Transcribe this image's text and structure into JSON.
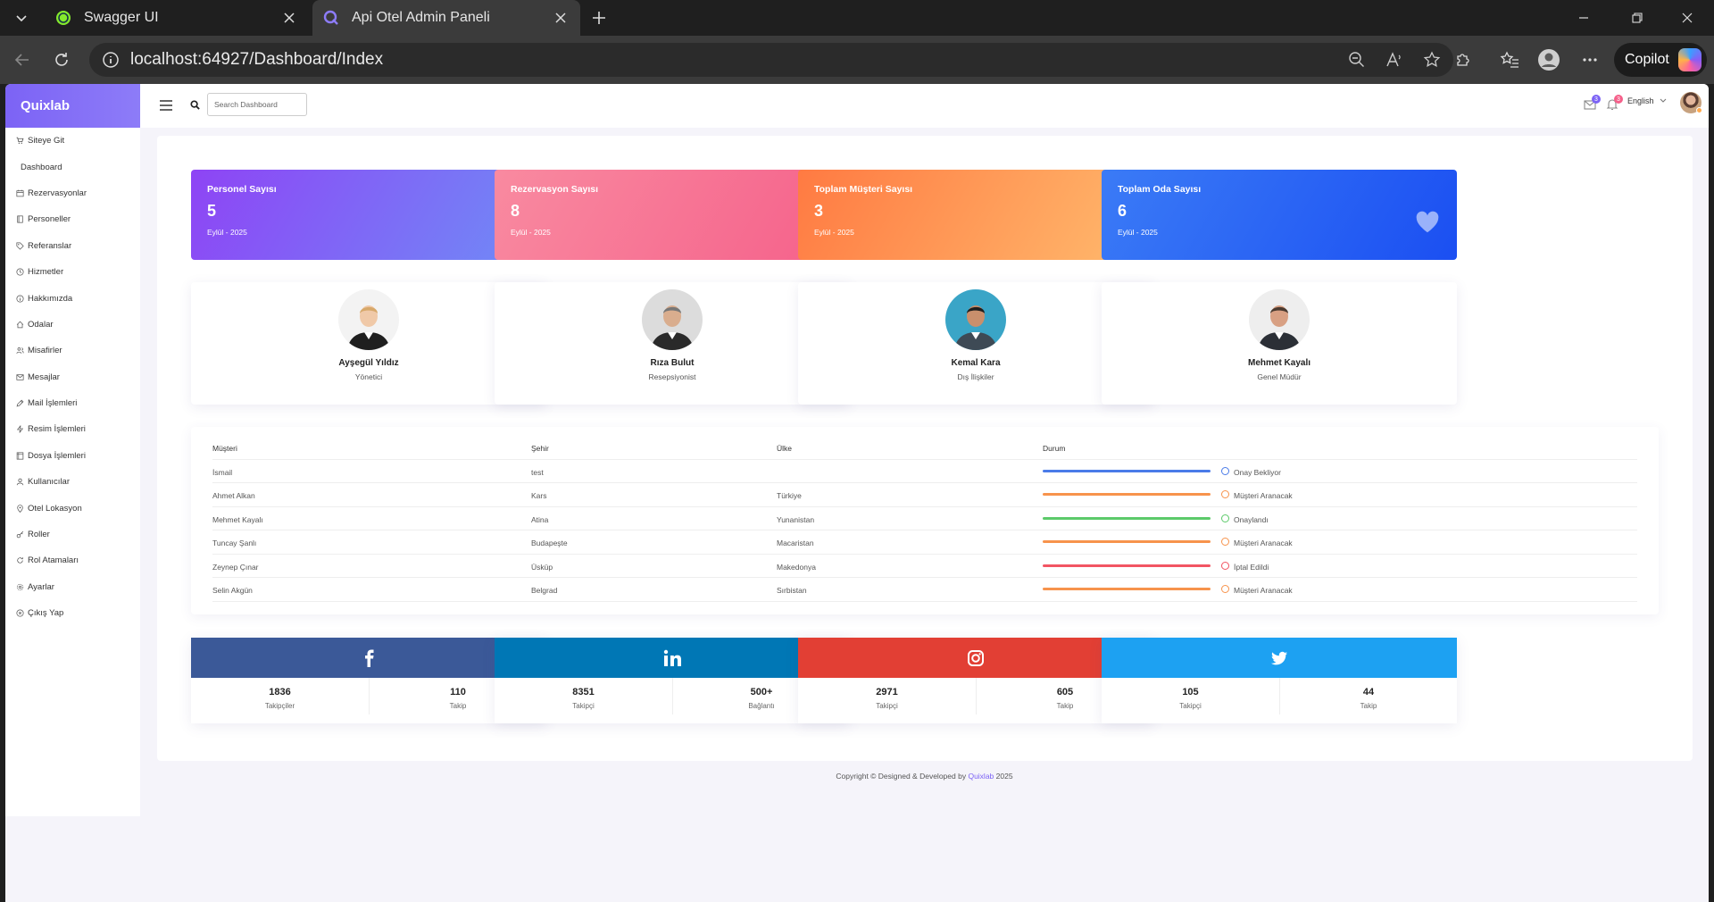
{
  "browser": {
    "tabs": [
      {
        "title": "Swagger UI",
        "icon": "swagger-icon"
      },
      {
        "title": "Api Otel Admin Paneli",
        "icon": "quixlab-icon",
        "active": true
      }
    ],
    "url": "localhost:64927/Dashboard/Index",
    "copilot_label": "Copilot"
  },
  "brand": "Quixlab",
  "sidebar": {
    "items": [
      {
        "label": "Siteye Git",
        "icon": "cart-icon"
      },
      {
        "label": "Dashboard",
        "icon": ""
      },
      {
        "label": "Rezervasyonlar",
        "icon": "calendar-icon"
      },
      {
        "label": "Personeller",
        "icon": "book-icon"
      },
      {
        "label": "Referanslar",
        "icon": "tag-icon"
      },
      {
        "label": "Hizmetler",
        "icon": "clock-icon"
      },
      {
        "label": "Hakkımızda",
        "icon": "info-icon"
      },
      {
        "label": "Odalar",
        "icon": "home-icon"
      },
      {
        "label": "Misafirler",
        "icon": "users-icon"
      },
      {
        "label": "Mesajlar",
        "icon": "mail-icon"
      },
      {
        "label": "Mail İşlemleri",
        "icon": "pencil-icon"
      },
      {
        "label": "Resim İşlemleri",
        "icon": "bolt-icon"
      },
      {
        "label": "Dosya İşlemleri",
        "icon": "file-icon"
      },
      {
        "label": "Kullanıcılar",
        "icon": "user-icon"
      },
      {
        "label": "Otel Lokasyon",
        "icon": "location-icon"
      },
      {
        "label": "Roller",
        "icon": "key-icon"
      },
      {
        "label": "Rol Atamaları",
        "icon": "refresh-icon"
      },
      {
        "label": "Ayarlar",
        "icon": "gear-icon"
      },
      {
        "label": "Çıkış Yap",
        "icon": "logout-icon"
      }
    ]
  },
  "header": {
    "search_placeholder": "Search Dashboard",
    "mail_badge": "3",
    "bell_badge": "3",
    "language": "English"
  },
  "stats": [
    {
      "label": "Personel Sayısı",
      "value": "5",
      "sub": "Eylül - 2025",
      "icon": "cart-icon",
      "gradient": [
        "#8e44f5",
        "#6f8df7"
      ]
    },
    {
      "label": "Rezervasyon Sayısı",
      "value": "8",
      "sub": "Eylül - 2025",
      "icon": "money-icon",
      "gradient": [
        "#f98aa0",
        "#f5608a"
      ]
    },
    {
      "label": "Toplam Müşteri Sayısı",
      "value": "3",
      "sub": "Eylül - 2025",
      "icon": "users-icon",
      "gradient": [
        "#ff7a42",
        "#ffbb6e"
      ]
    },
    {
      "label": "Toplam Oda Sayısı",
      "value": "6",
      "sub": "Eylül - 2025",
      "icon": "heart-icon",
      "gradient": [
        "#3b7bf6",
        "#1b4ff2"
      ]
    }
  ],
  "staff": [
    {
      "name": "Ayşegül Yıldız",
      "role": "Yönetici"
    },
    {
      "name": "Rıza Bulut",
      "role": "Resepsiyonist"
    },
    {
      "name": "Kemal Kara",
      "role": "Dış İlişkiler"
    },
    {
      "name": "Mehmet Kayalı",
      "role": "Genel Müdür"
    }
  ],
  "table": {
    "headers": [
      "Müşteri",
      "Şehir",
      "Ülke",
      "Durum"
    ],
    "rows": [
      {
        "customer": "İsmail",
        "city": "test",
        "country": "",
        "status": "Onay Bekliyor",
        "color": "#4a7be8"
      },
      {
        "customer": "Ahmet Alkan",
        "city": "Kars",
        "country": "Türkiye",
        "status": "Müşteri Aranacak",
        "color": "#f7934c"
      },
      {
        "customer": "Mehmet Kayalı",
        "city": "Atina",
        "country": "Yunanistan",
        "status": "Onaylandı",
        "color": "#5cca6a"
      },
      {
        "customer": "Tuncay Şanlı",
        "city": "Budapeşte",
        "country": "Macaristan",
        "status": "Müşteri Aranacak",
        "color": "#f7934c"
      },
      {
        "customer": "Zeynep Çınar",
        "city": "Üsküp",
        "country": "Makedonya",
        "status": "İptal Edildi",
        "color": "#f25563"
      },
      {
        "customer": "Selin Akgün",
        "city": "Belgrad",
        "country": "Sırbistan",
        "status": "Müşteri Aranacak",
        "color": "#f7934c"
      }
    ]
  },
  "social": [
    {
      "network": "facebook",
      "icon": "facebook-icon",
      "color": "#3b5998",
      "left_value": "1836",
      "left_label": "Takipçiler",
      "right_value": "110",
      "right_label": "Takip"
    },
    {
      "network": "linkedin",
      "icon": "linkedin-icon",
      "color": "#0077b5",
      "left_value": "8351",
      "left_label": "Takipçi",
      "right_value": "500+",
      "right_label": "Bağlantı"
    },
    {
      "network": "instagram",
      "icon": "instagram-icon",
      "color": "#e23f34",
      "left_value": "2971",
      "left_label": "Takipçi",
      "right_value": "605",
      "right_label": "Takip"
    },
    {
      "network": "twitter",
      "icon": "twitter-icon",
      "color": "#1da1f2",
      "left_value": "105",
      "left_label": "Takipçi",
      "right_value": "44",
      "right_label": "Takip"
    }
  ],
  "footer": {
    "text": "Copyright © Designed & Developed by",
    "brand": "Quixlab",
    "year": "2025"
  }
}
